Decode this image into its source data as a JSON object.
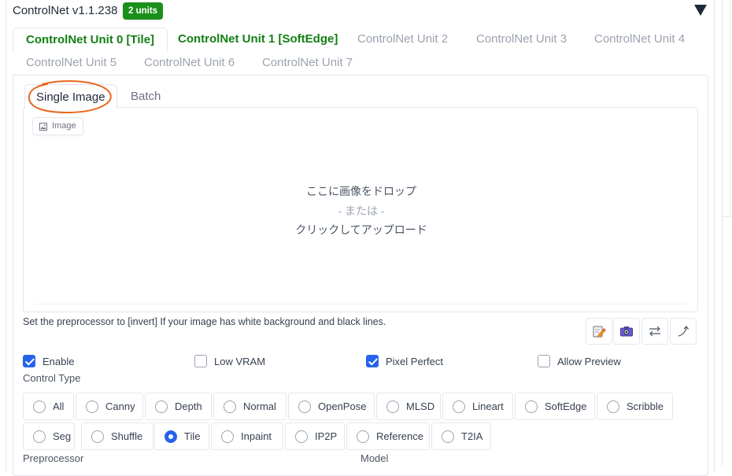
{
  "header": {
    "title": "ControlNet v1.1.238",
    "badge": "2 units"
  },
  "unit_tabs": [
    {
      "label": "ControlNet Unit 0 [Tile]"
    },
    {
      "label": "ControlNet Unit 1 [SoftEdge]"
    },
    {
      "label": "ControlNet Unit 2"
    },
    {
      "label": "ControlNet Unit 3"
    },
    {
      "label": "ControlNet Unit 4"
    },
    {
      "label": "ControlNet Unit 5"
    },
    {
      "label": "ControlNet Unit 6"
    },
    {
      "label": "ControlNet Unit 7"
    }
  ],
  "sub_tabs": [
    {
      "label": "Single Image"
    },
    {
      "label": "Batch"
    }
  ],
  "image_input": {
    "label": "Image",
    "drop_line1": "ここに画像をドロップ",
    "drop_or": "- または -",
    "drop_line2": "クリックしてアップロード"
  },
  "hint": "Set the preprocessor to [invert] If your image has white background and black lines.",
  "tools": [
    {
      "icon": "edit-icon"
    },
    {
      "icon": "camera-icon"
    },
    {
      "icon": "swap-icon"
    },
    {
      "icon": "curve-arrow-icon"
    }
  ],
  "checkboxes": [
    {
      "label": "Enable",
      "checked": true
    },
    {
      "label": "Low VRAM",
      "checked": false
    },
    {
      "label": "Pixel Perfect",
      "checked": true
    },
    {
      "label": "Allow Preview",
      "checked": false
    }
  ],
  "control_type": {
    "label": "Control Type",
    "selected": "Tile",
    "options": [
      "All",
      "Canny",
      "Depth",
      "Normal",
      "OpenPose",
      "MLSD",
      "Lineart",
      "SoftEdge",
      "Scribble",
      "Seg",
      "Shuffle",
      "Tile",
      "Inpaint",
      "IP2P",
      "Reference",
      "T2IA"
    ]
  },
  "preprocessor_label": "Preprocessor",
  "model_label": "Model",
  "colors": {
    "accent": "#2563eb",
    "badge": "#1b8f1b",
    "active_tab_text": "#127f12",
    "annotation": "#e8671b"
  }
}
